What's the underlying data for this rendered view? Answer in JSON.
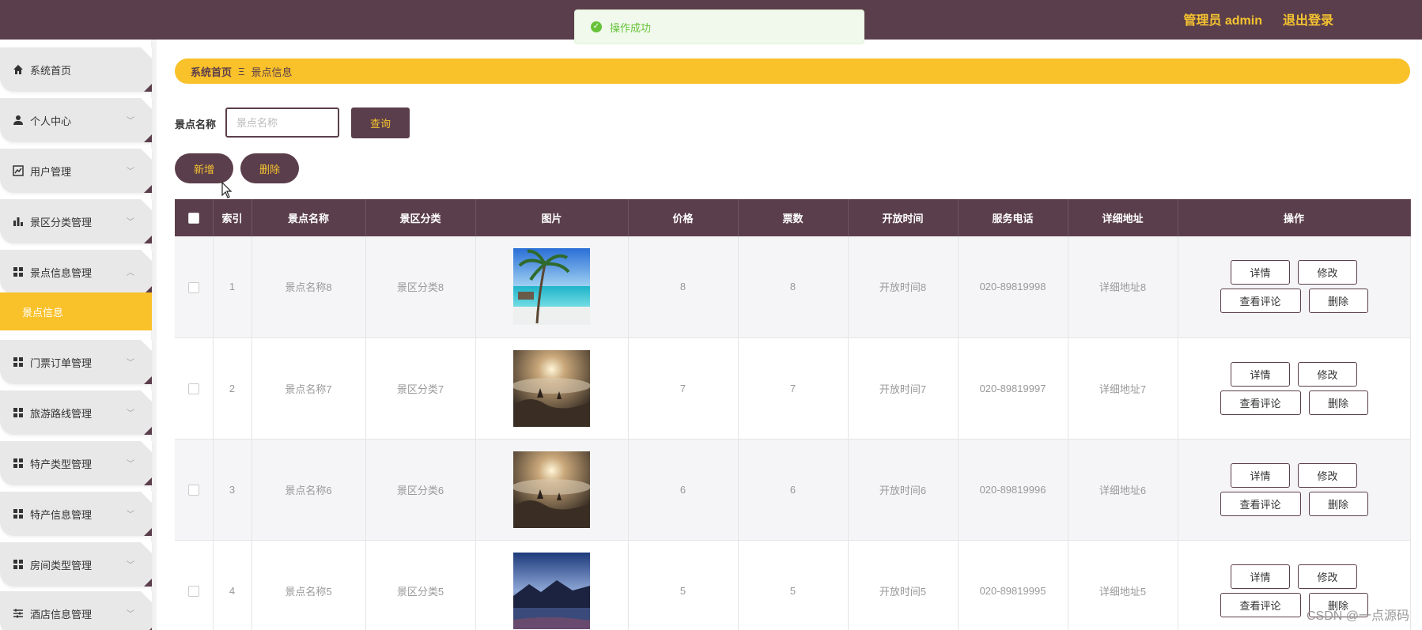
{
  "header": {
    "user_label": "管理员 admin",
    "logout_label": "退出登录"
  },
  "toast": {
    "message": "操作成功"
  },
  "sidebar": {
    "items": [
      {
        "label": "系统首页",
        "icon": "home-icon"
      },
      {
        "label": "个人中心",
        "icon": "user-icon"
      },
      {
        "label": "用户管理",
        "icon": "line-chart-icon"
      },
      {
        "label": "景区分类管理",
        "icon": "bar-chart-icon"
      },
      {
        "label": "景点信息管理",
        "icon": "grid-icon",
        "expanded": true
      },
      {
        "label": "门票订单管理",
        "icon": "grid-icon"
      },
      {
        "label": "旅游路线管理",
        "icon": "grid-icon"
      },
      {
        "label": "特产类型管理",
        "icon": "grid-icon"
      },
      {
        "label": "特产信息管理",
        "icon": "grid-icon"
      },
      {
        "label": "房间类型管理",
        "icon": "grid-icon"
      },
      {
        "label": "酒店信息管理",
        "icon": "sliders-icon"
      }
    ],
    "active_sub": "景点信息"
  },
  "breadcrumb": {
    "home": "系统首页",
    "sep": "Ξ",
    "current": "景点信息"
  },
  "search": {
    "label": "景点名称",
    "placeholder": "景点名称",
    "value": "",
    "query_label": "查询"
  },
  "actions": {
    "add_label": "新增",
    "delete_label": "删除"
  },
  "table": {
    "headers": [
      "",
      "索引",
      "景点名称",
      "景区分类",
      "图片",
      "价格",
      "票数",
      "开放时间",
      "服务电话",
      "详细地址",
      "操作"
    ],
    "rows": [
      {
        "index": "1",
        "name": "景点名称8",
        "category": "景区分类8",
        "image": "beach-palm-image",
        "price": "8",
        "tickets": "8",
        "open": "开放时间8",
        "phone": "020-89819998",
        "address": "详细地址8"
      },
      {
        "index": "2",
        "name": "景点名称7",
        "category": "景区分类7",
        "image": "misty-sunrise-image",
        "price": "7",
        "tickets": "7",
        "open": "开放时间7",
        "phone": "020-89819997",
        "address": "详细地址7"
      },
      {
        "index": "3",
        "name": "景点名称6",
        "category": "景区分类6",
        "image": "misty-sunrise-image",
        "price": "6",
        "tickets": "6",
        "open": "开放时间6",
        "phone": "020-89819996",
        "address": "详细地址6"
      },
      {
        "index": "4",
        "name": "景点名称5",
        "category": "景区分类5",
        "image": "lake-dusk-image",
        "price": "5",
        "tickets": "5",
        "open": "开放时间5",
        "phone": "020-89819995",
        "address": "详细地址5"
      }
    ],
    "op_labels": {
      "detail": "详情",
      "edit": "修改",
      "comments": "查看评论",
      "delete": "删除"
    }
  },
  "watermark": "CSDN @一点源码",
  "colors": {
    "primary": "#5b3e4b",
    "accent": "#f9c12a",
    "success": "#67c23a"
  }
}
